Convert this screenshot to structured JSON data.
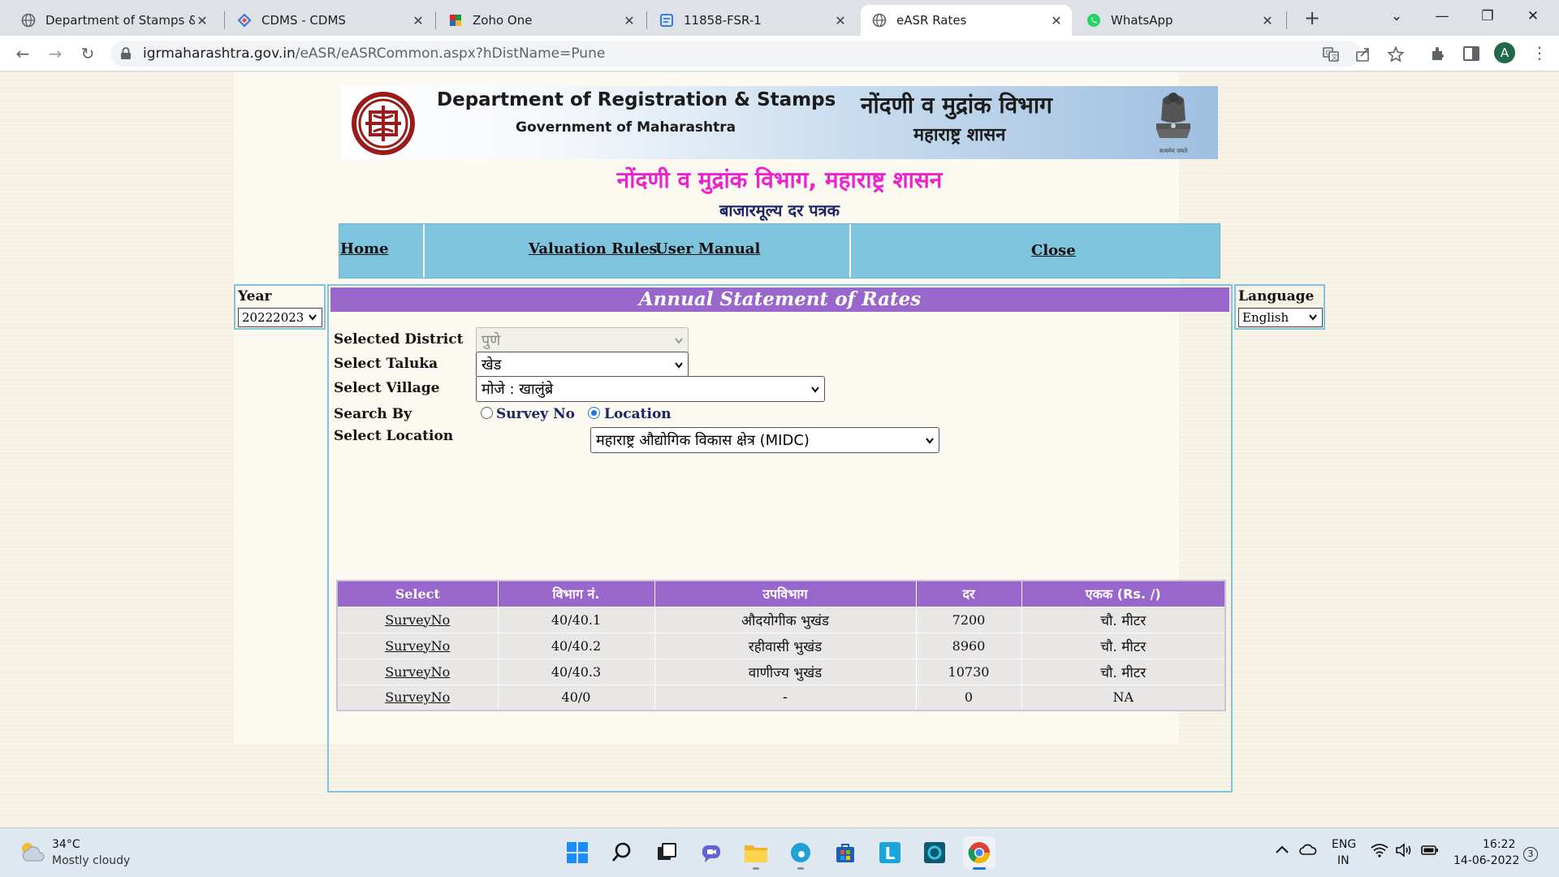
{
  "browser": {
    "tabs": [
      {
        "title": "Department of Stamps & Re",
        "icon": "globe-icon"
      },
      {
        "title": "CDMS - CDMS",
        "icon": "cdms-icon"
      },
      {
        "title": "Zoho One",
        "icon": "zoho-icon"
      },
      {
        "title": "11858-FSR-1",
        "icon": "document-icon"
      },
      {
        "title": "eASR Rates",
        "icon": "globe-icon",
        "active": true
      },
      {
        "title": "WhatsApp",
        "icon": "whatsapp-icon"
      }
    ],
    "url_host": "igrmaharashtra.gov.in",
    "url_path": "/eASR/eASRCommon.aspx?hDistName=Pune",
    "profile_initial": "A"
  },
  "banner": {
    "title_en": "Department of Registration & Stamps",
    "subtitle_en": "Government of Maharashtra",
    "title_mr": "नोंदणी व मुद्रांक विभाग",
    "subtitle_mr": "महाराष्ट्र शासन",
    "emblem_caption": "सत्यमेव जयते"
  },
  "page": {
    "heading": "नोंदणी व मुद्रांक विभाग, महाराष्ट्र शासन",
    "subheading": "बाजारमूल्य दर पत्रक"
  },
  "menu": {
    "home": "Home",
    "valuation_rules": "Valuation Rules",
    "user_manual": "User Manual",
    "close": "Close"
  },
  "year": {
    "label": "Year",
    "value": "20222023"
  },
  "language": {
    "label": "Language",
    "value": "English"
  },
  "panel": {
    "title": "Annual Statement of Rates"
  },
  "form": {
    "district_label": "Selected District",
    "district_value": "पुणे",
    "taluka_label": "Select Taluka",
    "taluka_value": "खेड",
    "village_label": "Select Village",
    "village_value": "मोजे : खालुंब्रे",
    "search_by_label": "Search By",
    "option_survey": "Survey No",
    "option_location": "Location",
    "selected_option": "Location",
    "location_label": "Select Location",
    "location_value": "महाराष्ट्र औद्योगिक विकास क्षेत्र (MIDC)"
  },
  "table": {
    "headers": [
      "Select",
      "विभाग नं.",
      "उपविभाग",
      "दर",
      "एकक (Rs. /)"
    ],
    "rows": [
      {
        "select": "SurveyNo",
        "division": "40/40.1",
        "subdivision": "औदयोगीक भुखंड",
        "rate": "7200",
        "unit": "चौ. मीटर"
      },
      {
        "select": "SurveyNo",
        "division": "40/40.2",
        "subdivision": "रहीवासी भुखंड",
        "rate": "8960",
        "unit": "चौ. मीटर"
      },
      {
        "select": "SurveyNo",
        "division": "40/40.3",
        "subdivision": "वाणीज्य भुखंड",
        "rate": "10730",
        "unit": "चौ. मीटर"
      },
      {
        "select": "SurveyNo",
        "division": "40/0",
        "subdivision": "-",
        "rate": "0",
        "unit": "NA"
      }
    ]
  },
  "taskbar": {
    "weather_temp": "34°C",
    "weather_desc": "Mostly cloudy",
    "lang_line1": "ENG",
    "lang_line2": "IN",
    "time": "16:22",
    "date": "14-06-2022",
    "notification_count": "3"
  },
  "colors": {
    "menu_blue": "#7ec4de",
    "header_purple": "#9966cc",
    "heading_magenta": "#ee22cc",
    "page_bg": "#f7f3e6"
  }
}
